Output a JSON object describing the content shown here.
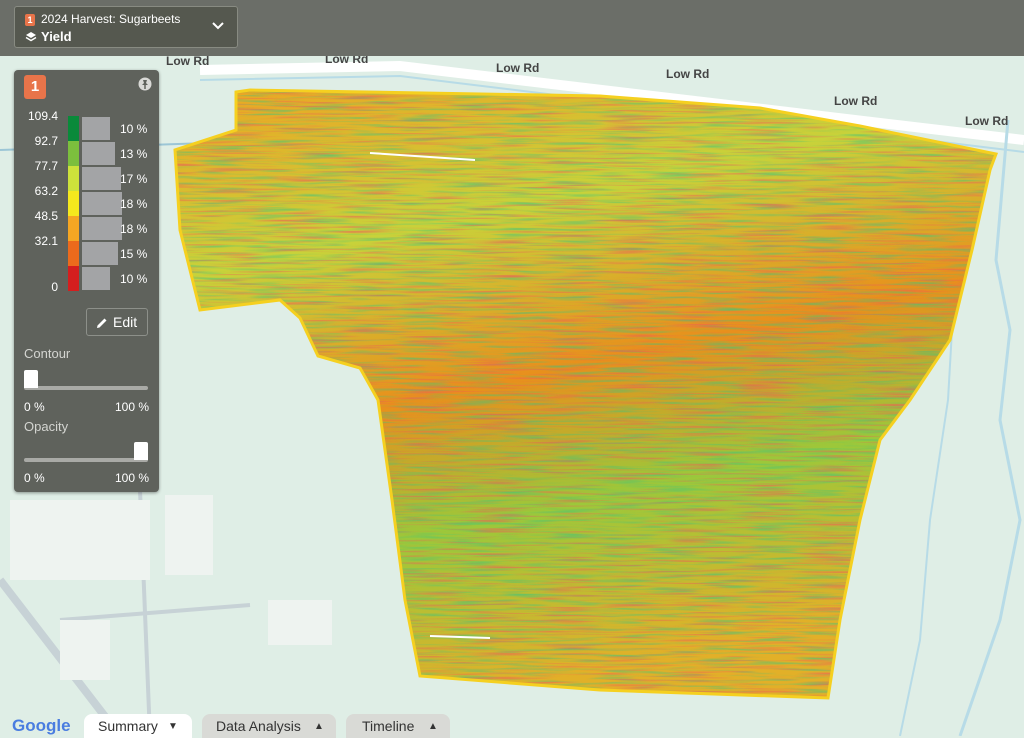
{
  "layer_selector": {
    "badge": "1",
    "title": "2024 Harvest: Sugarbeets",
    "layer": "Yield"
  },
  "map": {
    "roads": [
      "Low Rd",
      "Low Rd",
      "Low Rd",
      "Low Rd",
      "Low Rd"
    ],
    "attribution": "Google"
  },
  "legend": {
    "number": "1",
    "colors": [
      "#0a8a3a",
      "#7cbf3d",
      "#cde23b",
      "#f5e81d",
      "#f5a623",
      "#ec6a1c",
      "#d41e1e"
    ],
    "rows": [
      {
        "value": "109.4",
        "pct": "10 %",
        "fraction": 0.1
      },
      {
        "value": "92.7",
        "pct": "13 %",
        "fraction": 0.13
      },
      {
        "value": "77.7",
        "pct": "17 %",
        "fraction": 0.17
      },
      {
        "value": "63.2",
        "pct": "18 %",
        "fraction": 0.18
      },
      {
        "value": "48.5",
        "pct": "18 %",
        "fraction": 0.18
      },
      {
        "value": "32.1",
        "pct": "15 %",
        "fraction": 0.15
      },
      {
        "value": "0",
        "pct": "10 %",
        "fraction": 0.1
      }
    ],
    "edit_label": "Edit",
    "contour": {
      "label": "Contour",
      "min": "0 %",
      "max": "100 %",
      "value": 0
    },
    "opacity": {
      "label": "Opacity",
      "min": "0 %",
      "max": "100 %",
      "value": 1
    }
  },
  "tabs": [
    {
      "label": "Summary",
      "arrow": "▼"
    },
    {
      "label": "Data Analysis",
      "arrow": "▲"
    },
    {
      "label": "Timeline",
      "arrow": "▲"
    }
  ]
}
